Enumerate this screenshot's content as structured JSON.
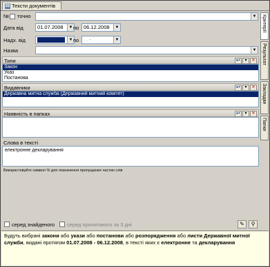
{
  "window": {
    "tab_title": "Тексти документів",
    "tab_icon": "$$"
  },
  "form": {
    "number_label": "№",
    "exact_label": "точно",
    "number_value": "",
    "date_from_label": "Дата від",
    "date_from_value": "01.07.2008",
    "date_to_label": "по",
    "date_to_value": "06.12.2008",
    "received_from_label": "Надх. від",
    "received_from_value": "",
    "received_to_label": "по",
    "received_to_value": ". . -",
    "name_label": "Назва",
    "name_value": ""
  },
  "types": {
    "header": "Типи",
    "items": [
      "Закон",
      "Указ",
      "Постанова"
    ],
    "selected_index": 0
  },
  "publishers": {
    "header": "Видавники",
    "items": [
      "Державна митна служба (Державний митний комітет)"
    ],
    "selected_index": 0
  },
  "folders": {
    "header": "Наявність в папках"
  },
  "words": {
    "label": "Слова в тексті",
    "value": "електронне декларування",
    "hint": "Використовуйте символ % для позначення пропущених частин слів"
  },
  "bottom": {
    "in_found_label": "серед знайденого",
    "in_read_label": "серед прочитаного за 3 дні"
  },
  "right_tabs": [
    "Критерії",
    "Результат",
    "Закладки",
    "Папки"
  ],
  "summary": {
    "p1": "Будуть вибрані ",
    "w1": "закони",
    "p2": " або ",
    "w2": "укази",
    "p3": " або ",
    "w3": "постанови",
    "p4": " або ",
    "w4": "розпорядження",
    "p5": " або ",
    "w5": "листи Державної митної служби",
    "p6": ", видані протягом ",
    "w6": "01.07.2008 - 06.12.2008",
    "p7": ", в тексті яких є ",
    "w7": "електронне",
    "p8": " та ",
    "w8": "декларування"
  },
  "colors": {
    "selection": "#0a246a",
    "summary_bg": "#ffffe6",
    "window_bg": "#d4d0c8"
  }
}
